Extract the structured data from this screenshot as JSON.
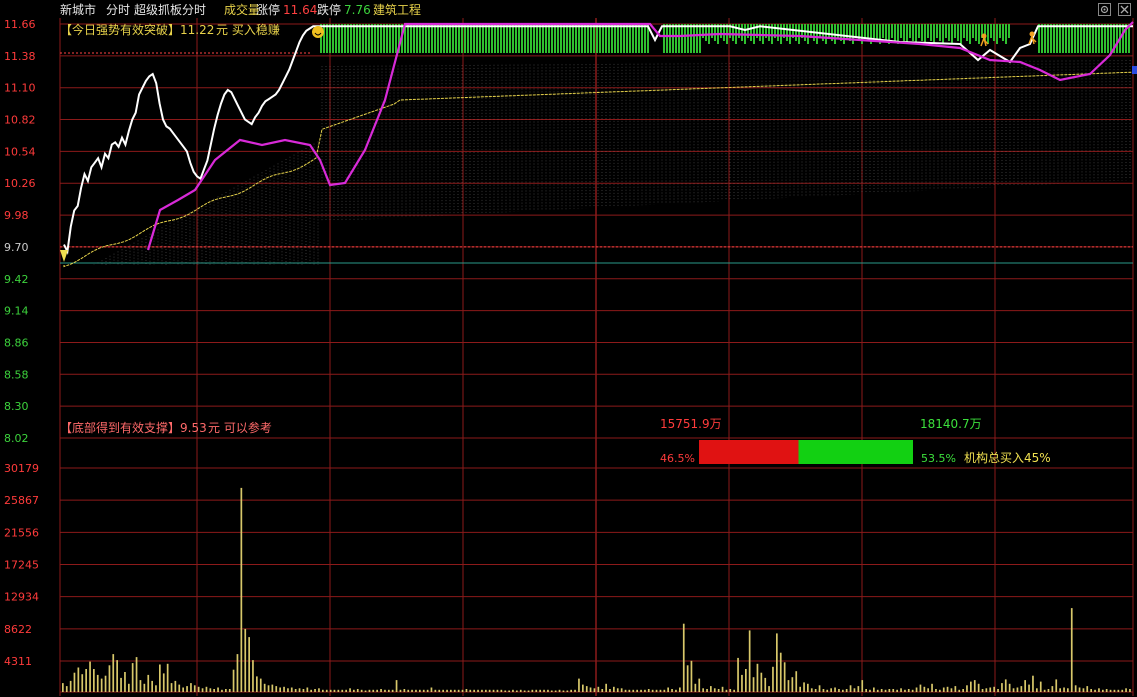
{
  "header": {
    "stock_name": "新城市",
    "mode_label": "分时",
    "indicator_name": "超级抓板分时",
    "volume_label": "成交量",
    "limit_up_label": "涨停",
    "limit_up_value": "11.64",
    "limit_down_label": "跌停",
    "limit_down_value": "7.76",
    "industry": "建筑工程"
  },
  "signals": {
    "breakout_text": "【今日强势有效突破】",
    "breakout_price": "11.22",
    "breakout_suffix": "元 买入稳赚",
    "support_text": "【底部得到有效支撑】",
    "support_price": "9.53",
    "support_suffix": "元 可以参考"
  },
  "flow": {
    "sell_amount": "15751.9万",
    "buy_amount": "18140.7万",
    "sell_pct": "46.5%",
    "buy_pct": "53.5%",
    "sell_fraction": 0.465,
    "buy_fraction": 0.535,
    "institution_label": "机构总买入45%"
  },
  "colors": {
    "background": "#000000",
    "grid": "#8c1a1a",
    "price_line": "#ffffff",
    "avg_line": "#e6d24a",
    "indicator_line": "#d82ad8",
    "band_fill": "#2fc02f",
    "sell_bar": "#e01212",
    "buy_bar": "#12d012",
    "axis_text": "#ff3b3b"
  },
  "chart_data": [
    {
      "type": "line",
      "title": "分时",
      "y_ticks": [
        "11.66",
        "11.38",
        "11.10",
        "10.82",
        "10.54",
        "10.26",
        "9.98",
        "9.70",
        "9.42",
        "9.14",
        "8.86",
        "8.58",
        "8.30",
        "8.02"
      ],
      "ylim": [
        8.02,
        11.66
      ],
      "prev_close": 9.7,
      "grid": true,
      "series": [
        {
          "name": "price",
          "values": [
            9.72,
            9.66,
            9.88,
            10.02,
            10.06,
            10.22,
            10.34,
            10.28,
            10.4,
            10.44,
            10.48,
            10.4,
            10.52,
            10.48,
            10.6,
            10.62,
            10.58,
            10.66,
            10.6,
            10.72,
            10.82,
            10.88,
            11.04,
            11.1,
            11.16,
            11.2,
            11.22,
            11.14,
            10.96,
            10.82,
            10.76,
            10.74,
            10.7,
            10.66,
            10.62,
            10.58,
            10.54,
            10.44,
            10.36,
            10.32,
            10.3,
            10.38,
            10.46,
            10.6,
            10.74,
            10.86,
            10.96,
            11.04,
            11.08,
            11.06,
            11.0,
            10.94,
            10.88,
            10.82,
            10.8,
            10.78,
            10.84,
            10.88,
            10.94,
            10.98,
            11.0,
            11.02,
            11.04,
            11.08,
            11.14,
            11.2,
            11.26,
            11.34,
            11.42,
            11.5,
            11.56,
            11.6,
            11.62,
            11.64,
            11.64,
            11.64
          ]
        }
      ]
    },
    {
      "type": "bar",
      "title": "成交量",
      "y_ticks": [
        "30179",
        "25867",
        "21556",
        "17245",
        "12934",
        "8622",
        "4311"
      ],
      "ylim": [
        0,
        30179
      ],
      "values": [
        1200,
        800,
        1500,
        2600,
        3300,
        2400,
        3100,
        4100,
        3100,
        2300,
        1800,
        2200,
        3600,
        5100,
        4300,
        1900,
        2700,
        1100,
        3900,
        4700,
        1600,
        1100,
        2300,
        1500,
        900,
        3700,
        2500,
        3800,
        1200,
        1500,
        1000,
        600,
        800,
        1200,
        900,
        700,
        500,
        700,
        500,
        400,
        600,
        300,
        400,
        400,
        3000,
        5100,
        27500,
        8500,
        7400,
        4300,
        2100,
        1800,
        1100,
        900,
        1000,
        800,
        600,
        700,
        500,
        600,
        400,
        500,
        400,
        600,
        300,
        400,
        500,
        300,
        300,
        300,
        300,
        300,
        300,
        300,
        500,
        300,
        400,
        300,
        200,
        300,
        300,
        300,
        400,
        300,
        300,
        300,
        1600,
        300,
        400,
        300,
        300,
        300,
        300,
        300,
        300,
        600,
        300,
        300,
        300,
        300,
        300,
        300,
        300,
        300,
        400,
        300,
        300,
        300,
        300,
        300,
        300,
        300,
        300,
        300,
        200,
        200,
        300,
        200,
        300,
        200,
        200,
        300,
        300,
        300,
        300,
        300,
        200,
        200,
        300,
        200,
        200,
        300,
        300,
        1800,
        1000,
        800,
        600,
        500,
        700,
        400,
        1100,
        400,
        700,
        500,
        500,
        300,
        300,
        300,
        300,
        300,
        300,
        400,
        300,
        300,
        300,
        300,
        600,
        400,
        300,
        600,
        9200,
        3600,
        4200,
        1100,
        1800,
        500,
        400,
        800,
        500,
        400,
        700,
        300,
        400,
        300,
        4600,
        2300,
        3100,
        8300,
        2000,
        3800,
        2600,
        1900,
        800,
        3400,
        7900,
        5300,
        4000,
        1600,
        2000,
        2800,
        700,
        1300,
        1100,
        500,
        400,
        900,
        400,
        300,
        500,
        600,
        400,
        300,
        400,
        900,
        500,
        800,
        1600,
        400,
        300,
        600,
        300,
        400,
        300,
        400,
        400,
        300,
        500,
        300,
        400,
        300,
        600,
        1000,
        700,
        500,
        1100,
        400,
        300,
        600,
        700,
        500,
        800,
        300,
        400,
        900,
        1400,
        1600,
        1100,
        400,
        500,
        600,
        700,
        400,
        1200,
        1700,
        1100,
        500,
        600,
        800,
        1600,
        1000,
        2200,
        500,
        1400,
        300,
        400,
        800,
        1700,
        500,
        600,
        500,
        11300,
        900,
        600,
        500,
        800,
        400,
        300,
        500,
        300,
        400,
        300,
        300,
        300,
        300,
        500,
        400
      ]
    }
  ]
}
